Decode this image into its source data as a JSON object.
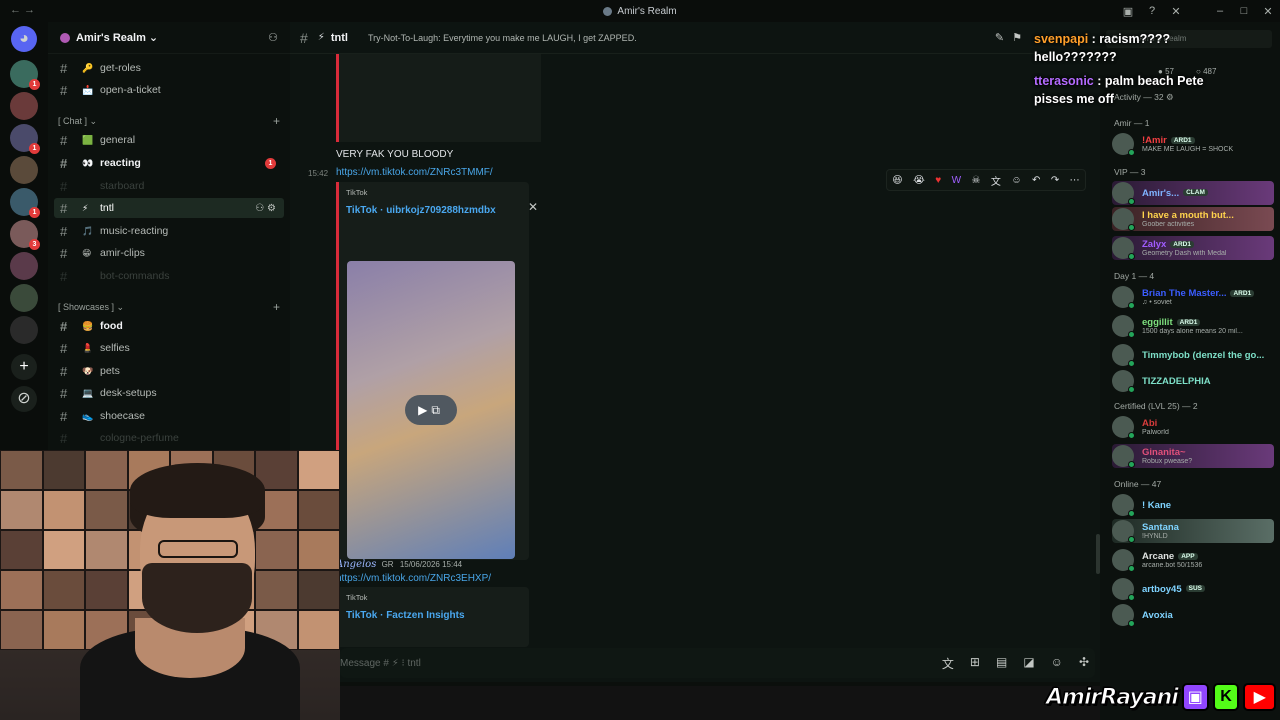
{
  "titlebar": {
    "title": "Amir's Realm",
    "back": "←  →"
  },
  "server": {
    "name": "Amir's Realm ⌄"
  },
  "channels": {
    "top": [
      {
        "emoji": "🔑",
        "name": "get-roles"
      },
      {
        "emoji": "📩",
        "name": "open-a-ticket"
      }
    ],
    "cat_chat": "[ Chat ] ⌄",
    "chat": [
      {
        "emoji": "🟩",
        "name": "general"
      },
      {
        "emoji": "👀",
        "name": "reacting",
        "badge": "1"
      },
      {
        "emoji": "",
        "name": "starboard"
      },
      {
        "emoji": "⚡",
        "name": "tntl"
      },
      {
        "emoji": "🎵",
        "name": "music-reacting"
      },
      {
        "emoji": "😁",
        "name": "amir-clips"
      },
      {
        "emoji": "",
        "name": "bot-commands"
      }
    ],
    "cat_showcases": "[ Showcases ] ⌄",
    "showcases": [
      {
        "emoji": "🍔",
        "name": "food"
      },
      {
        "emoji": "💄",
        "name": "selfies"
      },
      {
        "emoji": "🐶",
        "name": "pets"
      },
      {
        "emoji": "💻",
        "name": "desk-setups"
      },
      {
        "emoji": "👟",
        "name": "shoecase"
      },
      {
        "emoji": "",
        "name": "cologne-perfume"
      }
    ]
  },
  "chat_header": {
    "channel": "tntl",
    "topic": "Try-Not-To-Laugh: Everytime you make me LAUGH, I get ZAPPED."
  },
  "overlay_chat": [
    {
      "user": "svenpapi",
      "text": ": racism????",
      "cont": "hello???????"
    },
    {
      "user": "tterasonic",
      "text": ": palm beach Pete",
      "cont": "pisses me off"
    }
  ],
  "messages": {
    "m1_text": "VERY FAK YOU BLOODY",
    "m2_time": "15:42",
    "m2_link": "https://vm.tiktok.com/ZNRc3TMMF/",
    "embed1_provider": "TikTok",
    "embed1_title": "TikTok · uibrkojz709288hzmdbx",
    "m3_author": "Angelos",
    "m3_tag": "GR",
    "m3_time": "15/06/2026 15:44",
    "m3_link": "https://vm.tiktok.com/ZNRc3EHXP/",
    "embed2_provider": "TikTok",
    "embed2_title": "TikTok · Factzen Insights"
  },
  "composer": {
    "placeholder": "Message # ⚡ ⁝ tntl"
  },
  "members": {
    "search": "Search Amir's Realm",
    "stats_online": "57",
    "stats_total": "487",
    "activity": "Activity — 32 ⚙",
    "sections": [
      {
        "label": "Amir — 1",
        "items": [
          {
            "name": "!Amir",
            "tag": "ARD1",
            "status": "MAKE ME LAUGH = SHOCK",
            "color": "#f23f42"
          }
        ]
      },
      {
        "label": "VIP — 3",
        "items": [
          {
            "name": "Amir's...",
            "tag": "CLAM",
            "status": "",
            "color": "#7fb3ff",
            "hl": "hl"
          },
          {
            "name": "I have a mouth but...",
            "tag": "",
            "status": "Goober activities",
            "color": "#ffd34d",
            "hl": "hl2"
          },
          {
            "name": "Zalyx",
            "tag": "ARD1",
            "status": "Geometry Dash with Medal",
            "color": "#a15cff",
            "hl": "hl"
          }
        ]
      },
      {
        "label": "Day 1 — 4",
        "items": [
          {
            "name": "Brian The Master...",
            "tag": "ARD1",
            "status": "♫ • soviet",
            "color": "#3b5dff"
          },
          {
            "name": "eggillit",
            "tag": "ARD1",
            "status": "1500 days alone means 20 mil...",
            "color": "#7ee07e"
          },
          {
            "name": "Timmybob (denzel the go...",
            "tag": "",
            "status": "",
            "color": "#7ee0c8"
          },
          {
            "name": "TIZZADELPHIA",
            "tag": "",
            "status": "",
            "color": "#7ee0c8"
          }
        ]
      },
      {
        "label": "Certified (LVL 25) — 2",
        "items": [
          {
            "name": "Abi",
            "tag": "",
            "status": "Palworld",
            "color": "#d83c3c"
          },
          {
            "name": "Ginanita~",
            "tag": "",
            "status": "Robux pwease?",
            "color": "#e0507a",
            "hl": "hl"
          }
        ]
      },
      {
        "label": "Online — 47",
        "items": [
          {
            "name": "! Kane",
            "tag": "",
            "status": "",
            "color": "#7fd3ff"
          },
          {
            "name": "Santana",
            "tag": "",
            "status": "!HYNLD",
            "color": "#7fd3ff",
            "hl": "hl3"
          },
          {
            "name": "Arcane",
            "tag": "APP",
            "status": "arcane.bot 50/1536",
            "color": "#dfe2e0"
          },
          {
            "name": "artboy45",
            "tag": "SUS",
            "status": "",
            "color": "#7fd3ff"
          },
          {
            "name": "Avoxia",
            "tag": "",
            "status": "",
            "color": "#7fd3ff"
          }
        ]
      }
    ]
  },
  "logo": {
    "word": "AmirRayani",
    "k": "K"
  }
}
